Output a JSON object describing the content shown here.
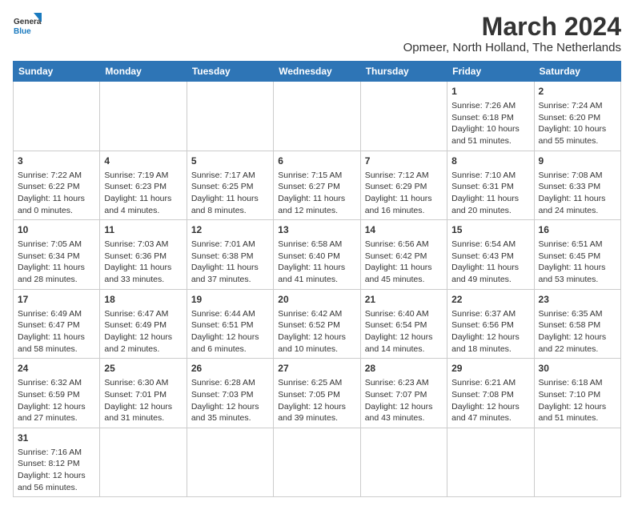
{
  "header": {
    "logo_general": "General",
    "logo_blue": "Blue",
    "title": "March 2024",
    "subtitle": "Opmeer, North Holland, The Netherlands"
  },
  "days_of_week": [
    "Sunday",
    "Monday",
    "Tuesday",
    "Wednesday",
    "Thursday",
    "Friday",
    "Saturday"
  ],
  "weeks": [
    [
      {
        "day": "",
        "content": ""
      },
      {
        "day": "",
        "content": ""
      },
      {
        "day": "",
        "content": ""
      },
      {
        "day": "",
        "content": ""
      },
      {
        "day": "",
        "content": ""
      },
      {
        "day": "1",
        "content": "Sunrise: 7:26 AM\nSunset: 6:18 PM\nDaylight: 10 hours and 51 minutes."
      },
      {
        "day": "2",
        "content": "Sunrise: 7:24 AM\nSunset: 6:20 PM\nDaylight: 10 hours and 55 minutes."
      }
    ],
    [
      {
        "day": "3",
        "content": "Sunrise: 7:22 AM\nSunset: 6:22 PM\nDaylight: 11 hours and 0 minutes."
      },
      {
        "day": "4",
        "content": "Sunrise: 7:19 AM\nSunset: 6:23 PM\nDaylight: 11 hours and 4 minutes."
      },
      {
        "day": "5",
        "content": "Sunrise: 7:17 AM\nSunset: 6:25 PM\nDaylight: 11 hours and 8 minutes."
      },
      {
        "day": "6",
        "content": "Sunrise: 7:15 AM\nSunset: 6:27 PM\nDaylight: 11 hours and 12 minutes."
      },
      {
        "day": "7",
        "content": "Sunrise: 7:12 AM\nSunset: 6:29 PM\nDaylight: 11 hours and 16 minutes."
      },
      {
        "day": "8",
        "content": "Sunrise: 7:10 AM\nSunset: 6:31 PM\nDaylight: 11 hours and 20 minutes."
      },
      {
        "day": "9",
        "content": "Sunrise: 7:08 AM\nSunset: 6:33 PM\nDaylight: 11 hours and 24 minutes."
      }
    ],
    [
      {
        "day": "10",
        "content": "Sunrise: 7:05 AM\nSunset: 6:34 PM\nDaylight: 11 hours and 28 minutes."
      },
      {
        "day": "11",
        "content": "Sunrise: 7:03 AM\nSunset: 6:36 PM\nDaylight: 11 hours and 33 minutes."
      },
      {
        "day": "12",
        "content": "Sunrise: 7:01 AM\nSunset: 6:38 PM\nDaylight: 11 hours and 37 minutes."
      },
      {
        "day": "13",
        "content": "Sunrise: 6:58 AM\nSunset: 6:40 PM\nDaylight: 11 hours and 41 minutes."
      },
      {
        "day": "14",
        "content": "Sunrise: 6:56 AM\nSunset: 6:42 PM\nDaylight: 11 hours and 45 minutes."
      },
      {
        "day": "15",
        "content": "Sunrise: 6:54 AM\nSunset: 6:43 PM\nDaylight: 11 hours and 49 minutes."
      },
      {
        "day": "16",
        "content": "Sunrise: 6:51 AM\nSunset: 6:45 PM\nDaylight: 11 hours and 53 minutes."
      }
    ],
    [
      {
        "day": "17",
        "content": "Sunrise: 6:49 AM\nSunset: 6:47 PM\nDaylight: 11 hours and 58 minutes."
      },
      {
        "day": "18",
        "content": "Sunrise: 6:47 AM\nSunset: 6:49 PM\nDaylight: 12 hours and 2 minutes."
      },
      {
        "day": "19",
        "content": "Sunrise: 6:44 AM\nSunset: 6:51 PM\nDaylight: 12 hours and 6 minutes."
      },
      {
        "day": "20",
        "content": "Sunrise: 6:42 AM\nSunset: 6:52 PM\nDaylight: 12 hours and 10 minutes."
      },
      {
        "day": "21",
        "content": "Sunrise: 6:40 AM\nSunset: 6:54 PM\nDaylight: 12 hours and 14 minutes."
      },
      {
        "day": "22",
        "content": "Sunrise: 6:37 AM\nSunset: 6:56 PM\nDaylight: 12 hours and 18 minutes."
      },
      {
        "day": "23",
        "content": "Sunrise: 6:35 AM\nSunset: 6:58 PM\nDaylight: 12 hours and 22 minutes."
      }
    ],
    [
      {
        "day": "24",
        "content": "Sunrise: 6:32 AM\nSunset: 6:59 PM\nDaylight: 12 hours and 27 minutes."
      },
      {
        "day": "25",
        "content": "Sunrise: 6:30 AM\nSunset: 7:01 PM\nDaylight: 12 hours and 31 minutes."
      },
      {
        "day": "26",
        "content": "Sunrise: 6:28 AM\nSunset: 7:03 PM\nDaylight: 12 hours and 35 minutes."
      },
      {
        "day": "27",
        "content": "Sunrise: 6:25 AM\nSunset: 7:05 PM\nDaylight: 12 hours and 39 minutes."
      },
      {
        "day": "28",
        "content": "Sunrise: 6:23 AM\nSunset: 7:07 PM\nDaylight: 12 hours and 43 minutes."
      },
      {
        "day": "29",
        "content": "Sunrise: 6:21 AM\nSunset: 7:08 PM\nDaylight: 12 hours and 47 minutes."
      },
      {
        "day": "30",
        "content": "Sunrise: 6:18 AM\nSunset: 7:10 PM\nDaylight: 12 hours and 51 minutes."
      }
    ],
    [
      {
        "day": "31",
        "content": "Sunrise: 7:16 AM\nSunset: 8:12 PM\nDaylight: 12 hours and 56 minutes."
      },
      {
        "day": "",
        "content": ""
      },
      {
        "day": "",
        "content": ""
      },
      {
        "day": "",
        "content": ""
      },
      {
        "day": "",
        "content": ""
      },
      {
        "day": "",
        "content": ""
      },
      {
        "day": "",
        "content": ""
      }
    ]
  ]
}
